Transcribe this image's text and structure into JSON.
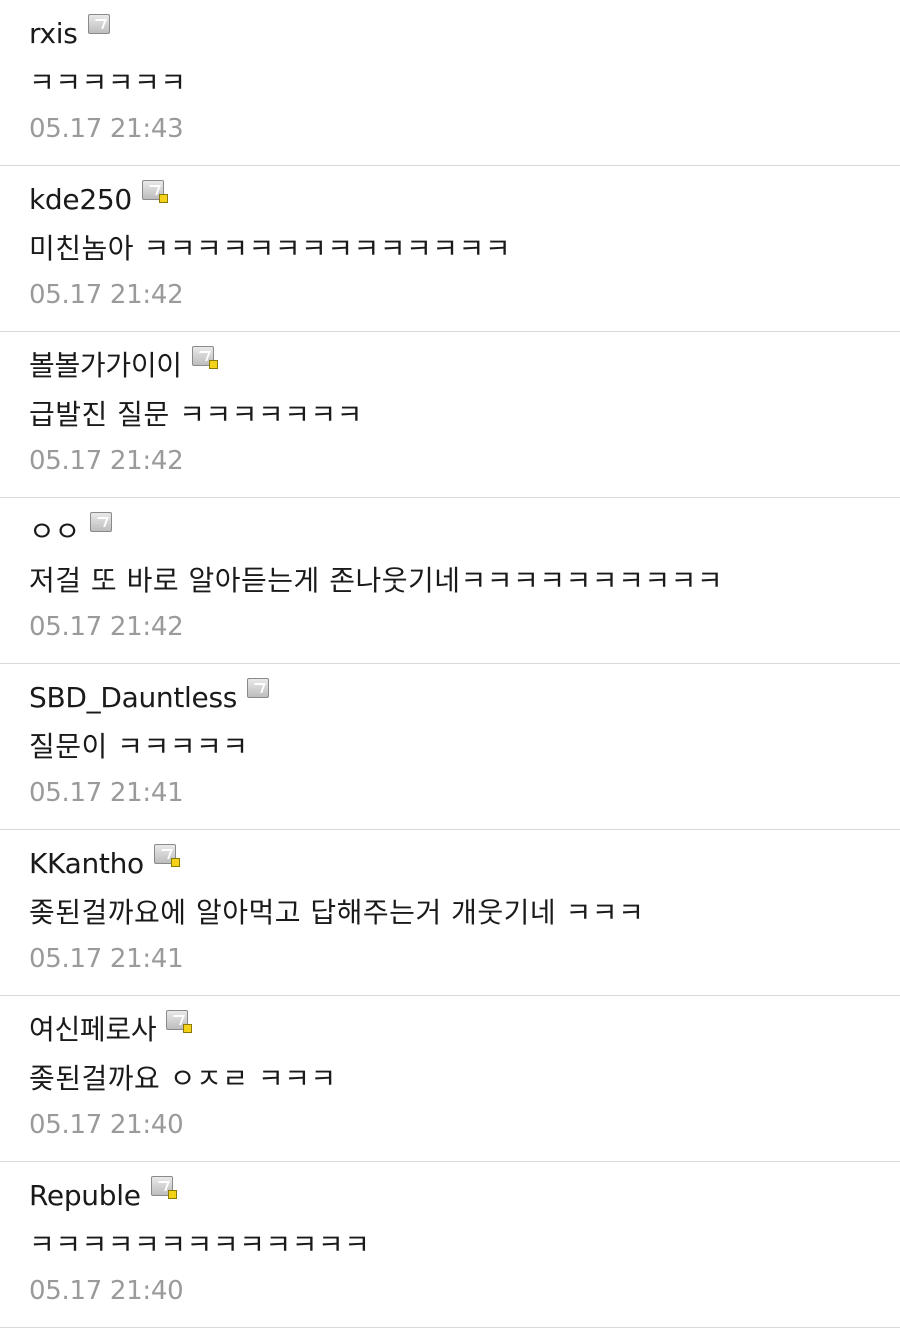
{
  "comments": [
    {
      "author": "rxis",
      "badge": "gray",
      "text": "ㅋㅋㅋㅋㅋㅋ",
      "time": "05.17 21:43"
    },
    {
      "author": "kde250",
      "badge": "gold",
      "text": "미친놈아 ㅋㅋㅋㅋㅋㅋㅋㅋㅋㅋㅋㅋㅋㅋ",
      "time": "05.17 21:42"
    },
    {
      "author": "볼볼가가이이",
      "badge": "gold",
      "text": "급발진 질문 ㅋㅋㅋㅋㅋㅋㅋ",
      "time": "05.17 21:42"
    },
    {
      "author": "ㅇㅇ",
      "badge": "gray",
      "text": "저걸 또 바로 알아듣는게 존나웃기네ㅋㅋㅋㅋㅋㅋㅋㅋㅋㅋ",
      "time": "05.17 21:42"
    },
    {
      "author": "SBD_Dauntless",
      "badge": "gray",
      "text": "질문이 ㅋㅋㅋㅋㅋ",
      "time": "05.17 21:41"
    },
    {
      "author": "KKantho",
      "badge": "gold",
      "text": "좆된걸까요에 알아먹고 답해주는거 개웃기네 ㅋㅋㅋ",
      "time": "05.17 21:41"
    },
    {
      "author": "여신페로사",
      "badge": "gold",
      "text": "좆된걸까요 ㅇㅈㄹ ㅋㅋㅋ",
      "time": "05.17 21:40"
    },
    {
      "author": "Republe",
      "badge": "gold",
      "text": "ㅋㅋㅋㅋㅋㅋㅋㅋㅋㅋㅋㅋㅋ",
      "time": "05.17 21:40"
    }
  ],
  "colors": {
    "text": "#1a1a1a",
    "time": "#9a9a9a",
    "divider": "#d9d9d9",
    "badge_gold": "#f5d21a"
  },
  "icons": {
    "gray": "gallery-user-icon",
    "gold": "fixed-nick-user-icon"
  }
}
